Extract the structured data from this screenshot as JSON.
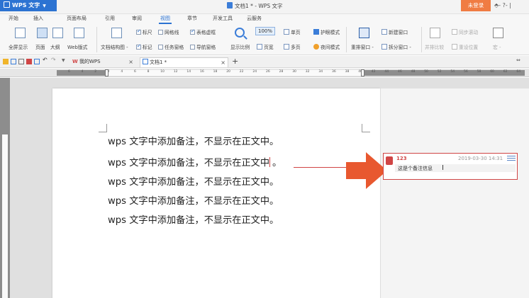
{
  "title_bar": {
    "app_name": "WPS 文字",
    "document_title": "文档1 * - WPS 文字",
    "login_label": "未登录",
    "right_controls": "⬘- ?- |"
  },
  "menu_tabs": [
    "开始",
    "插入",
    "页面布局",
    "引用",
    "审阅",
    "视图",
    "章节",
    "开发工具",
    "云服务"
  ],
  "active_menu_tab": "视图",
  "ribbon": {
    "view_buttons": [
      "全屏显示",
      "页面",
      "大纲",
      "Web版式"
    ],
    "doc_structure_label": "文档结构图 -",
    "checkboxes_row1": [
      {
        "label": "标尺",
        "checked": true
      },
      {
        "label": "网格线",
        "checked": false
      },
      {
        "label": "表格虚框",
        "checked": true
      }
    ],
    "checkboxes_row2": [
      {
        "label": "标记",
        "checked": true
      },
      {
        "label": "任务窗格",
        "checked": false
      },
      {
        "label": "导航窗格",
        "checked": false
      }
    ],
    "zoom_label": "显示比例",
    "zoom_value": "100%",
    "single_page": "单页",
    "full_page": "页宽",
    "multi_page": "多页",
    "protect_mode": "护眼模式",
    "night_mode": "夜间模式",
    "rearrange_window": "重排窗口 -",
    "new_window": "新建窗口",
    "split_window": "拆分窗口 -",
    "side_by_side": "并排比较",
    "sync_scroll": "同步滚动",
    "reset_position": "重设位置",
    "macro": "宏 -"
  },
  "quick_toolbar": {
    "wps_tab": "我的WPS",
    "doc_tab": "文档1 *",
    "close_symbol": "×",
    "add_symbol": "+"
  },
  "ruler": {
    "numbers": [
      "6",
      "4",
      "2",
      "2",
      "4",
      "6",
      "8",
      "10",
      "12",
      "14",
      "16",
      "18",
      "20",
      "22",
      "24",
      "26",
      "28",
      "30",
      "32",
      "34",
      "36",
      "38",
      "40",
      "42",
      "44",
      "46",
      "48",
      "50",
      "52",
      "54",
      "56",
      "58",
      "60",
      "62",
      "64"
    ]
  },
  "document": {
    "lines": [
      "wps 文字中添加备注，不显示在正文中。",
      "wps 文字中添加备注，不显示在正文中",
      "wps 文字中添加备注，不显示在正文中。",
      "wps 文字中添加备注，不显示在正文中。",
      "wps 文字中添加备注，不显示在正文中。"
    ],
    "line2_tail": "。"
  },
  "comment": {
    "user": "123",
    "timestamp": "2019-03-30 14:31",
    "text": "这是个备注信息",
    "accent_color": "#d04545"
  },
  "colors": {
    "accent_blue": "#2c73d2",
    "login_orange": "#f07c43",
    "arrow_orange": "#e8582f"
  }
}
